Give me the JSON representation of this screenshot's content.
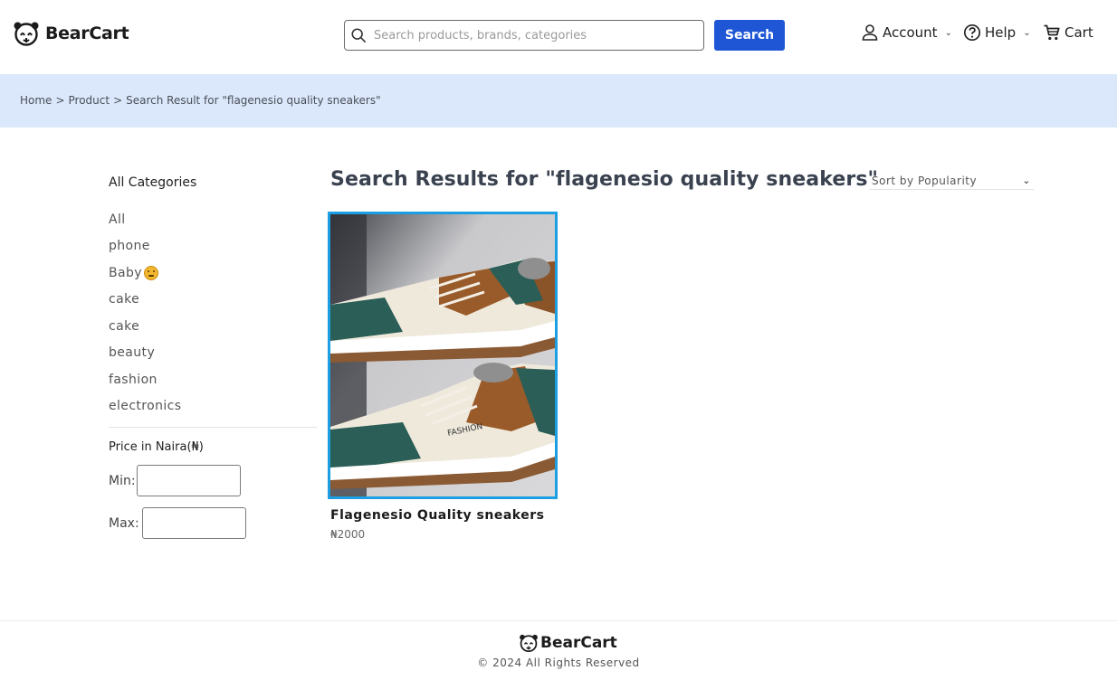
{
  "header": {
    "logo_text": "BearCart",
    "search_placeholder": "Search products, brands, categories",
    "search_button": "Search",
    "nav": {
      "account": "Account",
      "help": "Help",
      "cart": "Cart"
    }
  },
  "breadcrumb": {
    "home": "Home",
    "product": "Product",
    "current": "Search Result for \"flagenesio quality sneakers\"",
    "sep": ">"
  },
  "sidebar": {
    "categories_title": "All Categories",
    "categories": [
      "All",
      "phone",
      "Baby",
      "cake",
      "cake",
      "beauty",
      "fashion",
      "electronics"
    ],
    "price_title": "Price in Naira(₦)",
    "min_label": "Min:",
    "max_label": "Max:"
  },
  "main": {
    "results_title": "Search Results for \"flagenesio quality sneakers\"",
    "sort_label": "Sort by Popularity",
    "products": [
      {
        "name": "Flagenesio Quality sneakers",
        "price": "₦2000",
        "image_text": "FASHION"
      }
    ]
  },
  "footer": {
    "logo_text": "BearCart",
    "copyright": "© 2024 All Rights Reserved"
  },
  "colors": {
    "accent": "#1f56d6",
    "band": "#dbe8fb",
    "card_border": "#1b9ee2"
  },
  "icons": [
    "bear-logo-icon",
    "search-icon",
    "user-icon",
    "help-icon",
    "cart-icon",
    "chevron-down-icon",
    "smiley-emoji-icon"
  ]
}
